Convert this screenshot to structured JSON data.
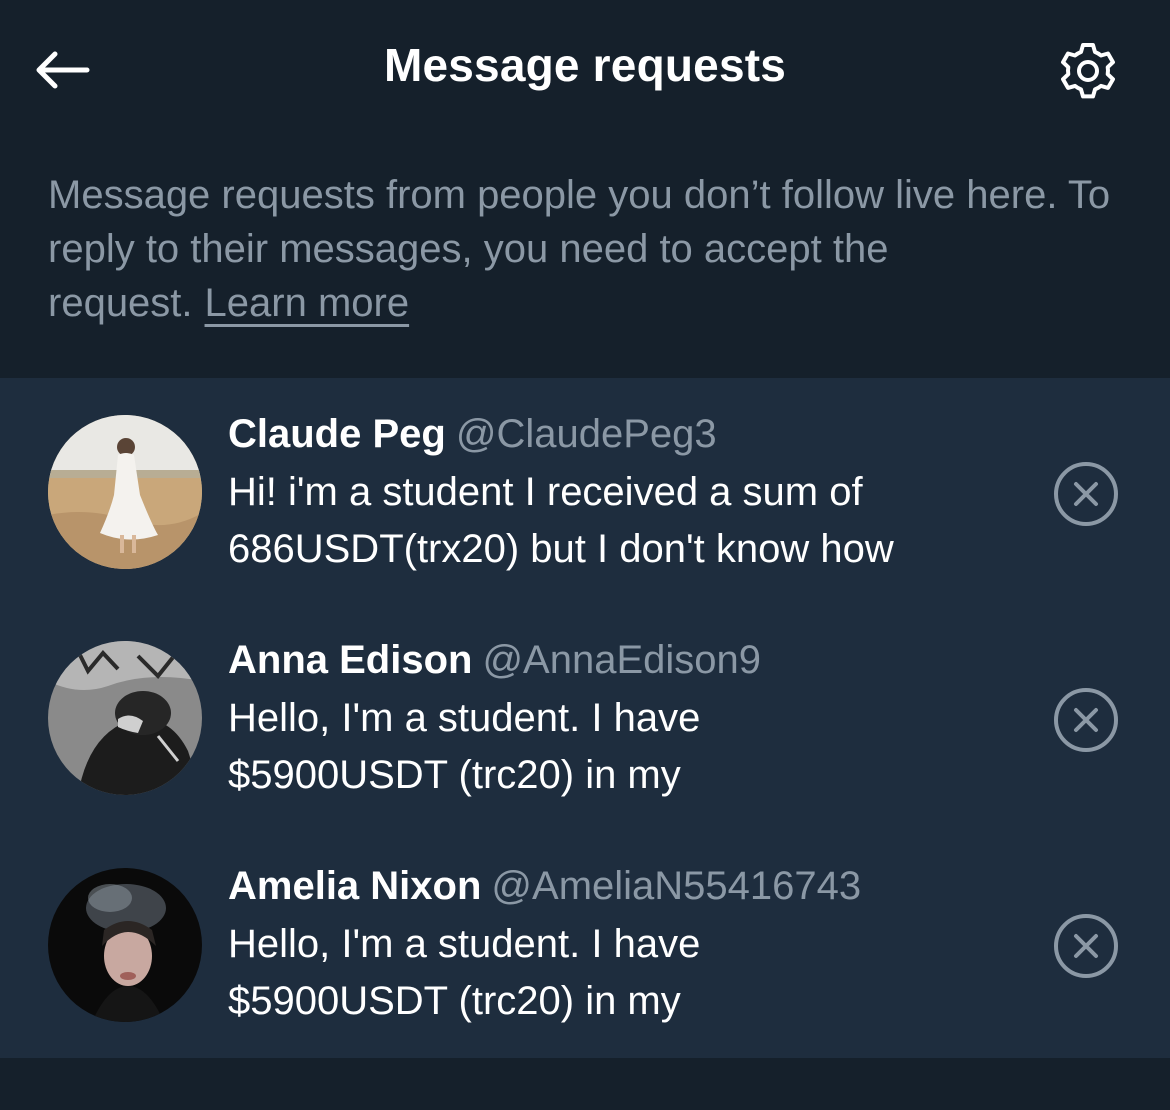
{
  "header": {
    "title": "Message requests",
    "back_icon": "arrow-left-icon",
    "settings_icon": "gear-icon"
  },
  "intro": {
    "text": "Message requests from people you don’t follow live here. To reply to their messages, you need to accept the request.",
    "link": "Learn more"
  },
  "requests": [
    {
      "name": "Claude Peg",
      "handle": "@ClaudePeg3",
      "message_lines": [
        "Hi!  i'm a student  I received a sum of",
        "686USDT(trx20) but I don't know how"
      ]
    },
    {
      "name": "Anna Edison",
      "handle": "@AnnaEdison9",
      "message_lines": [
        "Hello, I'm a student. I have",
        "$5900USDT (trc20) in my"
      ]
    },
    {
      "name": "Amelia Nixon",
      "handle": "@AmeliaN55416743",
      "message_lines": [
        "Hello, I'm a student. I have",
        "$5900USDT (trc20) in my"
      ]
    }
  ],
  "colors": {
    "background": "#15202b",
    "list_background": "#1e2d3e",
    "secondary_text": "#8b98a5",
    "primary_text": "#ffffff"
  }
}
